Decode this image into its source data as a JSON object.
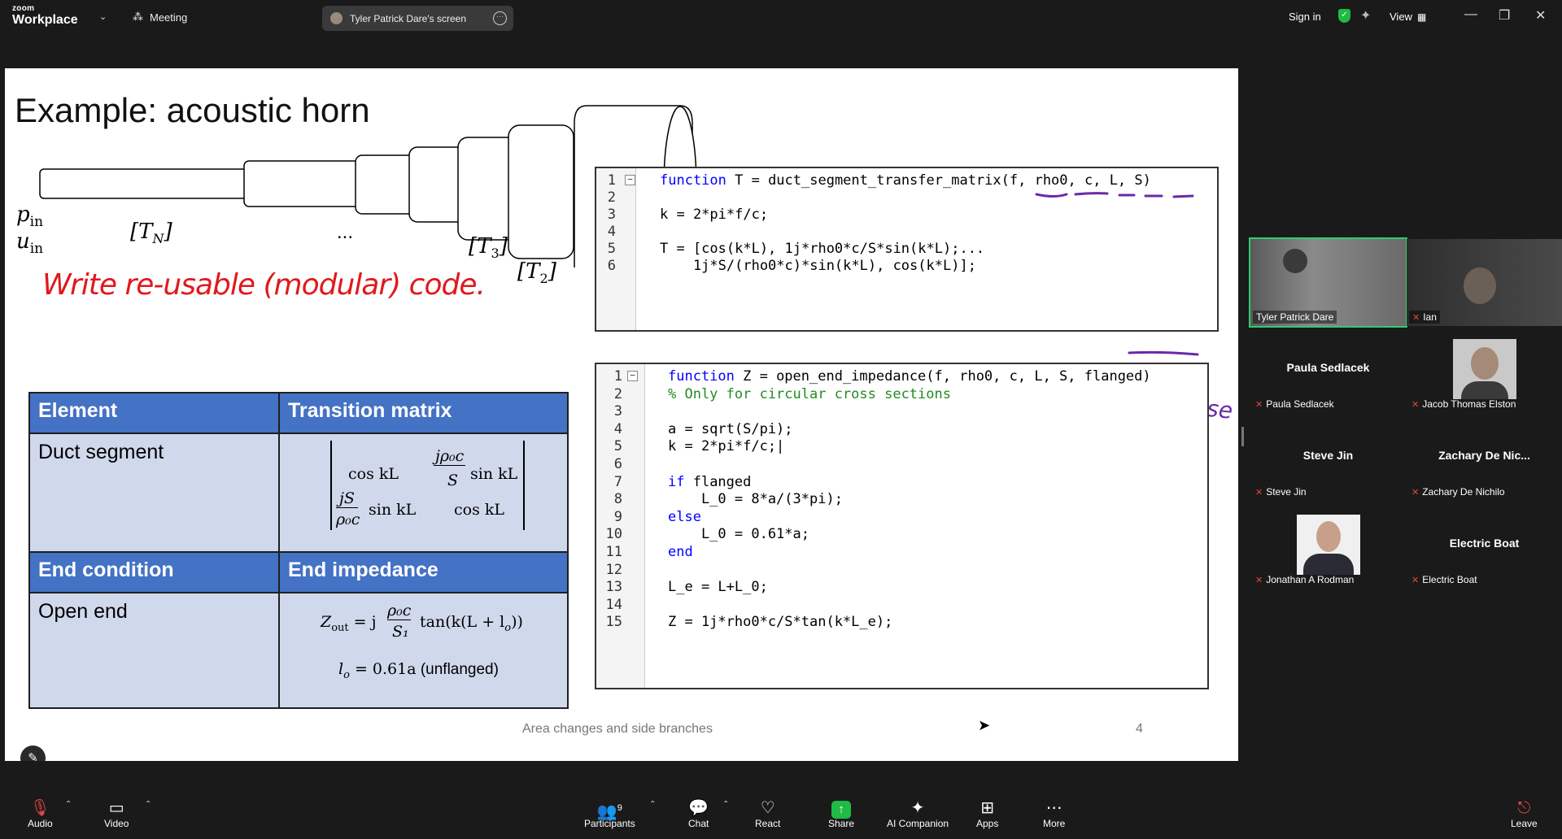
{
  "topbar": {
    "brand_top": "zoom",
    "brand_bottom": "Workplace",
    "meeting_label": "Meeting",
    "screen_label": "Tyler Patrick Dare's screen",
    "sign_in": "Sign in",
    "view": "View"
  },
  "slide": {
    "title": "Example: acoustic horn",
    "labels": {
      "p_in": "p",
      "p_sub": "in",
      "u_in": "u",
      "u_sub": "in",
      "tn": "[T",
      "tn_sub": "N",
      "dots": "...",
      "t3": "[T",
      "t3_sub": "3",
      "t2": "[T",
      "t2_sub": "2"
    },
    "annotations": {
      "modular": "Write re-usable (modular) code.",
      "truefalse": "true/false"
    },
    "code1": {
      "line_numbers": [
        "1",
        "2",
        "3",
        "4",
        "5",
        "6"
      ],
      "lines": [
        {
          "kw": "function",
          "text": " T = duct_segment_transfer_matrix(f, rho0, c, L, S)"
        },
        {
          "kw": "",
          "text": ""
        },
        {
          "kw": "",
          "text": "k = 2*pi*f/c;"
        },
        {
          "kw": "",
          "text": ""
        },
        {
          "kw": "",
          "text": "T = [cos(k*L), 1j*rho0*c/S*sin(k*L);..."
        },
        {
          "kw": "",
          "text": "    1j*S/(rho0*c)*sin(k*L), cos(k*L)];"
        }
      ]
    },
    "code2": {
      "line_numbers": [
        "1",
        "2",
        "3",
        "4",
        "5",
        "6",
        "7",
        "8",
        "9",
        "10",
        "11",
        "12",
        "13",
        "14",
        "15"
      ],
      "lines": [
        {
          "kw": "function",
          "cm": "",
          "text": " Z = open_end_impedance(f, rho0, c, L, S, flanged)"
        },
        {
          "kw": "",
          "cm": "% Only for circular cross sections",
          "text": ""
        },
        {
          "kw": "",
          "cm": "",
          "text": ""
        },
        {
          "kw": "",
          "cm": "",
          "text": "a = sqrt(S/pi);"
        },
        {
          "kw": "",
          "cm": "",
          "text": "k = 2*pi*f/c;|"
        },
        {
          "kw": "",
          "cm": "",
          "text": ""
        },
        {
          "kw": "if",
          "cm": "",
          "text": " flanged"
        },
        {
          "kw": "",
          "cm": "",
          "text": "    L_0 = 8*a/(3*pi);"
        },
        {
          "kw": "else",
          "cm": "",
          "text": ""
        },
        {
          "kw": "",
          "cm": "",
          "text": "    L_0 = 0.61*a;"
        },
        {
          "kw": "end",
          "cm": "",
          "text": ""
        },
        {
          "kw": "",
          "cm": "",
          "text": ""
        },
        {
          "kw": "",
          "cm": "",
          "text": "L_e = L+L_0;"
        },
        {
          "kw": "",
          "cm": "",
          "text": ""
        },
        {
          "kw": "",
          "cm": "",
          "text": "Z = 1j*rho0*c/S*tan(k*L_e);"
        }
      ]
    },
    "table1": {
      "header_left": "Element",
      "header_right": "Transition matrix",
      "row_left": "Duct segment",
      "m11": "cos kL",
      "m12_num": "jρ₀c",
      "m12_den": "S",
      "m12_tail": "sin kL",
      "m21_num": "jS",
      "m21_den": "ρ₀c",
      "m21_tail": "sin kL",
      "m22": "cos kL"
    },
    "table2": {
      "header_left": "End condition",
      "header_right": "End impedance",
      "row_left": "Open end",
      "z_lhs": "Z",
      "z_lhs_sub": "out",
      "z_eq": " = j",
      "z_num": "ρ₀c",
      "z_den": "S₁",
      "z_tail": "tan(k(L + l",
      "z_tail_sub": "o",
      "z_end": "))",
      "lo": "l",
      "lo_sub": "o",
      "lo_val": " = 0.61a",
      "lo_note": " (unflanged)"
    },
    "footer": "Area changes and side branches",
    "page": "4"
  },
  "participants": {
    "videos": [
      {
        "name": "Tyler Patrick Dare"
      },
      {
        "name": "Ian"
      }
    ],
    "tiles": [
      {
        "big": "Paula Sedlacek",
        "small": "Paula Sedlacek"
      },
      {
        "big": "",
        "small": "Jacob Thomas Elston"
      },
      {
        "big": "Steve Jin",
        "small": "Steve Jin"
      },
      {
        "big": "Zachary De Nic...",
        "small": "Zachary De Nichilo"
      },
      {
        "big": "",
        "small": "Jonathan A Rodman"
      },
      {
        "big": "Electric Boat",
        "small": "Electric Boat"
      }
    ]
  },
  "toolbar": {
    "audio": "Audio",
    "video": "Video",
    "participants": "Participants",
    "participants_count": "9",
    "chat": "Chat",
    "react": "React",
    "share": "Share",
    "ai": "AI Companion",
    "apps": "Apps",
    "more": "More",
    "leave": "Leave"
  },
  "colors": {
    "accent_green": "#1fbb45",
    "table_header": "#4472c4",
    "table_body": "#d0d8ec",
    "ink_red": "#e0191d",
    "ink_purple": "#6a2aa8"
  }
}
